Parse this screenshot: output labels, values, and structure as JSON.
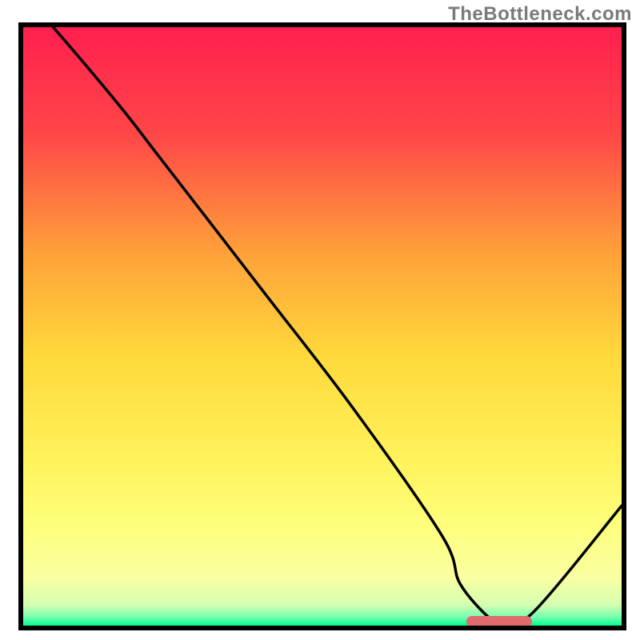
{
  "watermark": "TheBottleneck.com",
  "chart_data": {
    "type": "line",
    "title": "",
    "xlabel": "",
    "ylabel": "",
    "xlim": [
      0,
      100
    ],
    "ylim": [
      0,
      100
    ],
    "grid": false,
    "legend": false,
    "x": [
      0,
      5,
      16,
      23,
      40,
      55,
      70,
      73,
      78,
      80,
      85,
      100
    ],
    "values": [
      105,
      100,
      87,
      78,
      56,
      36.5,
      15,
      7,
      1.2,
      1,
      2,
      20
    ],
    "background_gradient_stops": [
      {
        "offset": 0.0,
        "color": "#ff1f4f"
      },
      {
        "offset": 0.18,
        "color": "#ff4747"
      },
      {
        "offset": 0.38,
        "color": "#ffa23a"
      },
      {
        "offset": 0.55,
        "color": "#ffd93b"
      },
      {
        "offset": 0.72,
        "color": "#fff25a"
      },
      {
        "offset": 0.84,
        "color": "#fdff7e"
      },
      {
        "offset": 0.92,
        "color": "#f9ffa2"
      },
      {
        "offset": 0.965,
        "color": "#d6ffb0"
      },
      {
        "offset": 0.985,
        "color": "#7affb0"
      },
      {
        "offset": 1.0,
        "color": "#00ff90"
      }
    ],
    "marker": {
      "x_start": 74,
      "x_end": 85,
      "y": 0.7
    }
  },
  "colors": {
    "curve": "#000000",
    "border": "#000000",
    "marker": "#e16a6d",
    "watermark": "#7a7a7a"
  }
}
